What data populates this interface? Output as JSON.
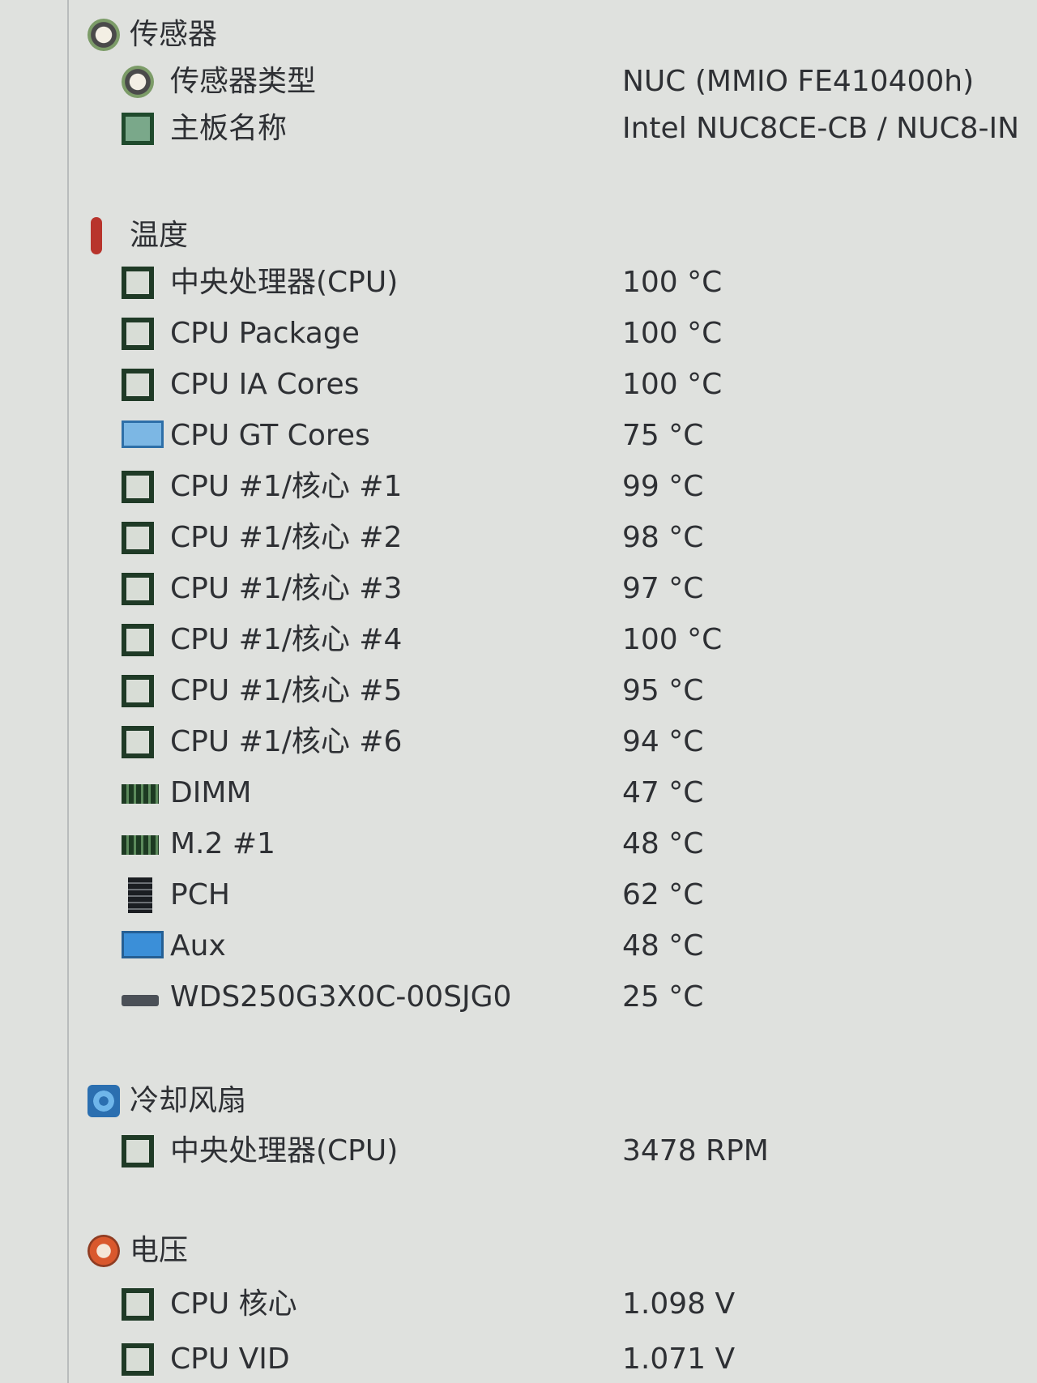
{
  "sections": [
    {
      "key": "sensor",
      "title": "传感器",
      "icon": "sensor-icon",
      "items": [
        {
          "label": "传感器类型",
          "value": "NUC  (MMIO FE410400h)",
          "icon": "sensor-icon"
        },
        {
          "label": "主板名称",
          "value": "Intel NUC8CE-CB / NUC8-IN",
          "icon": "motherboard-icon"
        }
      ]
    },
    {
      "key": "temperature",
      "title": "温度",
      "icon": "thermometer-icon",
      "items": [
        {
          "label": "中央处理器(CPU)",
          "value": "100 °C",
          "icon": "cpu-icon"
        },
        {
          "label": "CPU Package",
          "value": "100 °C",
          "icon": "cpu-icon"
        },
        {
          "label": "CPU IA Cores",
          "value": "100 °C",
          "icon": "cpu-icon"
        },
        {
          "label": "CPU GT Cores",
          "value": "75 °C",
          "icon": "gpu-icon"
        },
        {
          "label": "CPU #1/核心 #1",
          "value": "99 °C",
          "icon": "cpu-icon"
        },
        {
          "label": "CPU #1/核心 #2",
          "value": "98 °C",
          "icon": "cpu-icon"
        },
        {
          "label": "CPU #1/核心 #3",
          "value": "97 °C",
          "icon": "cpu-icon"
        },
        {
          "label": "CPU #1/核心 #4",
          "value": "100 °C",
          "icon": "cpu-icon"
        },
        {
          "label": "CPU #1/核心 #5",
          "value": "95 °C",
          "icon": "cpu-icon"
        },
        {
          "label": "CPU #1/核心 #6",
          "value": "94 °C",
          "icon": "cpu-icon"
        },
        {
          "label": "DIMM",
          "value": "47 °C",
          "icon": "ram-icon"
        },
        {
          "label": "M.2 #1",
          "value": "48 °C",
          "icon": "ram-icon"
        },
        {
          "label": "PCH",
          "value": "62 °C",
          "icon": "chip-icon"
        },
        {
          "label": "Aux",
          "value": "48 °C",
          "icon": "monitor-icon"
        },
        {
          "label": "WDS250G3X0C-00SJG0",
          "value": "25 °C",
          "icon": "drive-icon"
        }
      ]
    },
    {
      "key": "fans",
      "title": "冷却风扇",
      "icon": "fan-icon",
      "items": [
        {
          "label": "中央处理器(CPU)",
          "value": "3478 RPM",
          "icon": "cpu-icon"
        }
      ]
    },
    {
      "key": "voltage",
      "title": "电压",
      "icon": "voltage-icon",
      "items": [
        {
          "label": "CPU 核心",
          "value": "1.098 V",
          "icon": "cpu-icon"
        },
        {
          "label": "CPU VID",
          "value": "1.071 V",
          "icon": "cpu-icon"
        }
      ]
    }
  ]
}
